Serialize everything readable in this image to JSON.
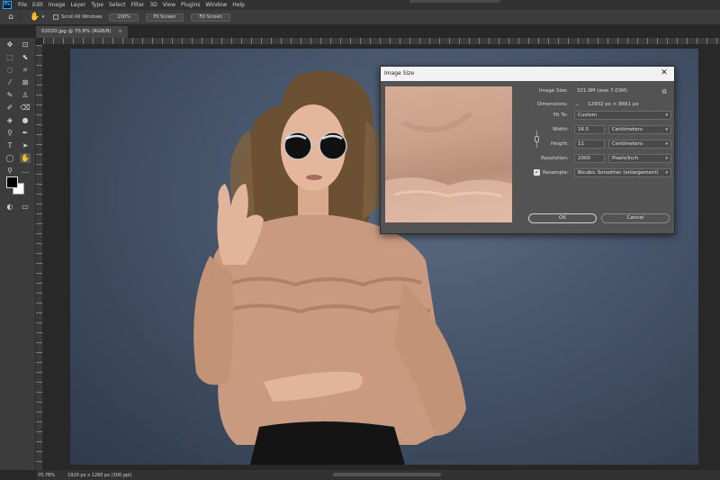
{
  "menu": {
    "logo": "Ps",
    "items": [
      "File",
      "Edit",
      "Image",
      "Layer",
      "Type",
      "Select",
      "Filter",
      "3D",
      "View",
      "Plugins",
      "Window",
      "Help"
    ]
  },
  "options": {
    "scroll_all_windows": "Scroll All Windows",
    "zoom_100": "100%",
    "fit_screen": "Fit Screen",
    "fill_screen": "Fill Screen"
  },
  "tab": {
    "label": "02020.jpg @ 70.8% (RGB/8)",
    "close": "×"
  },
  "status": {
    "zoom": "70.78%",
    "info": "1920 px x 1280 px (300 ppi)"
  },
  "dialog": {
    "title": "Image Size",
    "close": "✕",
    "image_size_label": "Image Size:",
    "image_size_value": "321.9M (was 7.03M)",
    "dimensions_label": "Dimensions:",
    "dimensions_value": "12992 px  ×  8661 px",
    "fit_to_label": "Fit To:",
    "fit_to_value": "Custom",
    "width_label": "Width:",
    "width_value": "16.5",
    "width_unit": "Centimeters",
    "height_label": "Height:",
    "height_value": "11",
    "height_unit": "Centimeters",
    "resolution_label": "Resolution:",
    "resolution_value": "2000",
    "resolution_unit": "Pixels/Inch",
    "resample_label": "Resample:",
    "resample_value": "Bicubic Smoother (enlargement)",
    "ok": "OK",
    "cancel": "Cancel",
    "resample_checked": true
  },
  "colors": {
    "background_photo": "#46546a",
    "blouse": "#c99a80",
    "skin": "#e2b59a",
    "hair": "#7a5c3e",
    "dialog_bg": "#535353",
    "accent_ps": "#31a8ff"
  }
}
